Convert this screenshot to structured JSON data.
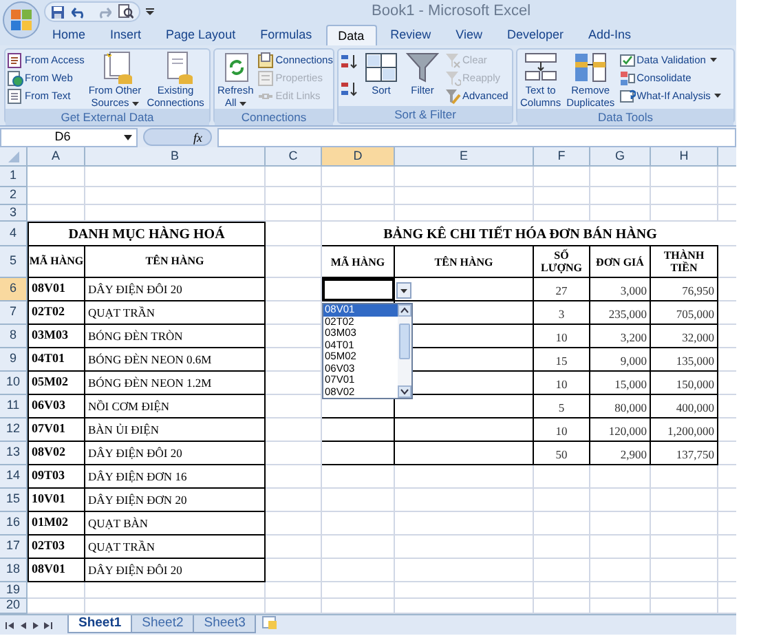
{
  "window": {
    "title": "Book1 - Microsoft Excel"
  },
  "ribbon_tabs": [
    {
      "label": "Home",
      "selected": false
    },
    {
      "label": "Insert",
      "selected": false
    },
    {
      "label": "Page Layout",
      "selected": false
    },
    {
      "label": "Formulas",
      "selected": false
    },
    {
      "label": "Data",
      "selected": true
    },
    {
      "label": "Review",
      "selected": false
    },
    {
      "label": "View",
      "selected": false
    },
    {
      "label": "Developer",
      "selected": false
    },
    {
      "label": "Add-Ins",
      "selected": false
    }
  ],
  "ribbon_groups": [
    {
      "label": "Get External Data",
      "columns": [
        {
          "kind": "stack",
          "commands": [
            {
              "label": "From Access",
              "disabled": false,
              "menu": false
            },
            {
              "label": "From Web",
              "disabled": false,
              "menu": false
            },
            {
              "label": "From Text",
              "disabled": false,
              "menu": false
            }
          ]
        },
        {
          "kind": "large",
          "label_lines": [
            "From Other",
            "Sources"
          ],
          "menu": true
        },
        {
          "kind": "large",
          "label_lines": [
            "Existing",
            "Connections"
          ],
          "menu": false
        }
      ]
    },
    {
      "label": "Connections",
      "columns": [
        {
          "kind": "large",
          "label_lines": [
            "Refresh",
            "All"
          ],
          "menu": true
        },
        {
          "kind": "stack",
          "commands": [
            {
              "label": "Connections",
              "disabled": false,
              "menu": false
            },
            {
              "label": "Properties",
              "disabled": true,
              "menu": false
            },
            {
              "label": "Edit Links",
              "disabled": true,
              "menu": false
            }
          ]
        }
      ]
    },
    {
      "label": "Sort & Filter",
      "columns": [
        {
          "kind": "sort_pair"
        },
        {
          "kind": "large",
          "label_lines": [
            "Sort"
          ],
          "menu": false
        },
        {
          "kind": "large",
          "label_lines": [
            "Filter"
          ],
          "menu": false
        },
        {
          "kind": "stack",
          "commands": [
            {
              "label": "Clear",
              "disabled": true,
              "menu": false
            },
            {
              "label": "Reapply",
              "disabled": true,
              "menu": false
            },
            {
              "label": "Advanced",
              "disabled": false,
              "menu": false
            }
          ]
        }
      ]
    },
    {
      "label": "Data Tools",
      "columns": [
        {
          "kind": "large",
          "label_lines": [
            "Text to",
            "Columns"
          ],
          "menu": false
        },
        {
          "kind": "large",
          "label_lines": [
            "Remove",
            "Duplicates"
          ],
          "menu": false
        },
        {
          "kind": "stack",
          "commands": [
            {
              "label": "Data Validation",
              "disabled": false,
              "menu": true
            },
            {
              "label": "Consolidate",
              "disabled": false,
              "menu": false
            },
            {
              "label": "What-If Analysis",
              "disabled": false,
              "menu": true
            }
          ]
        }
      ]
    }
  ],
  "formula_bar": {
    "name_box": "D6",
    "function_button": "fx"
  },
  "column_headers": [
    {
      "label": "A",
      "selected": false
    },
    {
      "label": "B",
      "selected": false
    },
    {
      "label": "C",
      "selected": false
    },
    {
      "label": "D",
      "selected": true
    },
    {
      "label": "E",
      "selected": false
    },
    {
      "label": "F",
      "selected": false
    },
    {
      "label": "G",
      "selected": false
    },
    {
      "label": "H",
      "selected": false
    }
  ],
  "row_headers": [
    {
      "label": "1",
      "selected": false
    },
    {
      "label": "2",
      "selected": false
    },
    {
      "label": "3",
      "selected": false
    },
    {
      "label": "4",
      "selected": false
    },
    {
      "label": "5",
      "selected": false
    },
    {
      "label": "6",
      "selected": true
    },
    {
      "label": "7",
      "selected": false
    },
    {
      "label": "8",
      "selected": false
    },
    {
      "label": "9",
      "selected": false
    },
    {
      "label": "10",
      "selected": false
    },
    {
      "label": "11",
      "selected": false
    },
    {
      "label": "12",
      "selected": false
    },
    {
      "label": "13",
      "selected": false
    },
    {
      "label": "14",
      "selected": false
    },
    {
      "label": "15",
      "selected": false
    },
    {
      "label": "16",
      "selected": false
    },
    {
      "label": "17",
      "selected": false
    },
    {
      "label": "18",
      "selected": false
    },
    {
      "label": "19",
      "selected": false
    },
    {
      "label": "20",
      "selected": false
    }
  ],
  "product_table": {
    "title": "DANH MỤC HÀNG HOÁ",
    "headers": [
      "MÃ HÀNG",
      "TÊN HÀNG"
    ],
    "rows": [
      {
        "code": "08V01",
        "name": "DÂY ĐIỆN ĐÔI 20"
      },
      {
        "code": "02T02",
        "name": "QUẠT TRẦN"
      },
      {
        "code": "03M03",
        "name": "BÓNG ĐÈN TRÒN"
      },
      {
        "code": "04T01",
        "name": "BÓNG ĐÈN NEON 0.6M"
      },
      {
        "code": "05M02",
        "name": "BÓNG ĐÈN NEON 1.2M"
      },
      {
        "code": "06V03",
        "name": "NỒI CƠM ĐIỆN"
      },
      {
        "code": "07V01",
        "name": "BÀN ỦI ĐIỆN"
      },
      {
        "code": "08V02",
        "name": "DÂY ĐIỆN ĐÔI 20"
      },
      {
        "code": "09T03",
        "name": "DÂY ĐIỆN ĐƠN 16"
      },
      {
        "code": "10V01",
        "name": "DÂY ĐIỆN ĐƠN 20"
      },
      {
        "code": "01M02",
        "name": "QUẠT BÀN"
      },
      {
        "code": "02T03",
        "name": "QUẠT TRẦN"
      },
      {
        "code": "08V01",
        "name": "DÂY ĐIỆN ĐÔI 20"
      }
    ]
  },
  "invoice_table": {
    "title": "BẢNG KÊ CHI TIẾT HÓA ĐƠN BÁN HÀNG",
    "headers": [
      "MÃ HÀNG",
      "TÊN HÀNG",
      "SỐ LƯỢNG",
      "ĐƠN GIÁ",
      "THÀNH TIỀN"
    ],
    "rows": [
      {
        "quantity": "27",
        "unit_price": "3,000",
        "amount": "76,950"
      },
      {
        "quantity": "3",
        "unit_price": "235,000",
        "amount": "705,000"
      },
      {
        "quantity": "10",
        "unit_price": "3,200",
        "amount": "32,000"
      },
      {
        "quantity": "15",
        "unit_price": "9,000",
        "amount": "135,000"
      },
      {
        "quantity": "10",
        "unit_price": "15,000",
        "amount": "150,000"
      },
      {
        "quantity": "5",
        "unit_price": "80,000",
        "amount": "400,000"
      },
      {
        "quantity": "10",
        "unit_price": "120,000",
        "amount": "1,200,000"
      },
      {
        "quantity": "50",
        "unit_price": "2,900",
        "amount": "137,750"
      }
    ]
  },
  "dropdown": {
    "items": [
      {
        "label": "08V01",
        "selected": true
      },
      {
        "label": "02T02",
        "selected": false
      },
      {
        "label": "03M03",
        "selected": false
      },
      {
        "label": "04T01",
        "selected": false
      },
      {
        "label": "05M02",
        "selected": false
      },
      {
        "label": "06V03",
        "selected": false
      },
      {
        "label": "07V01",
        "selected": false
      },
      {
        "label": "08V02",
        "selected": false
      }
    ]
  },
  "sheet_tabs": [
    {
      "label": "Sheet1",
      "selected": true
    },
    {
      "label": "Sheet2",
      "selected": false
    },
    {
      "label": "Sheet3",
      "selected": false
    }
  ]
}
